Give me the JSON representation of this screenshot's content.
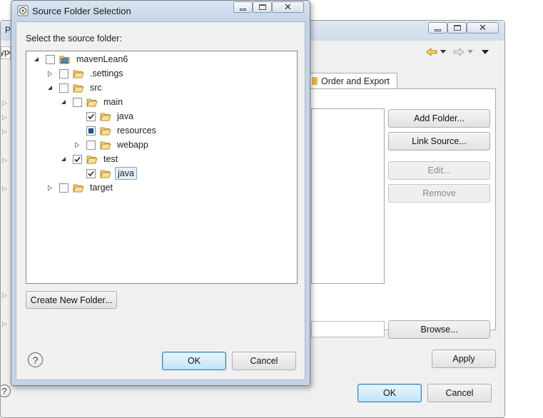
{
  "background_window": {
    "partial_title": "P",
    "partial_text": "ype",
    "tab_order_export": "Order and Export",
    "buttons": {
      "add_folder": "Add Folder...",
      "link_source": "Link Source...",
      "edit": "Edit...",
      "remove": "Remove",
      "browse": "Browse...",
      "apply": "Apply",
      "ok": "OK",
      "cancel": "Cancel"
    }
  },
  "dialog": {
    "title": "Source Folder Selection",
    "prompt": "Select the source folder:",
    "tree": [
      {
        "label": "mavenLean6",
        "expander": "expanded",
        "check": "unchecked",
        "level": 0
      },
      {
        "label": ".settings",
        "expander": "collapsed",
        "check": "unchecked",
        "level": 1
      },
      {
        "label": "src",
        "expander": "expanded",
        "check": "unchecked",
        "level": 1
      },
      {
        "label": "main",
        "expander": "expanded",
        "check": "unchecked",
        "level": 2
      },
      {
        "label": "java",
        "expander": "none",
        "check": "checked",
        "level": 3
      },
      {
        "label": "resources",
        "expander": "none",
        "check": "partial",
        "level": 3
      },
      {
        "label": "webapp",
        "expander": "collapsed",
        "check": "unchecked",
        "level": 3
      },
      {
        "label": "test",
        "expander": "expanded",
        "check": "checked",
        "level": 2
      },
      {
        "label": "java",
        "expander": "none",
        "check": "checked",
        "level": 3,
        "selected": true
      },
      {
        "label": "target",
        "expander": "collapsed",
        "check": "unchecked",
        "level": 1
      }
    ],
    "create_folder_label": "Create New Folder...",
    "ok_label": "OK",
    "cancel_label": "Cancel"
  },
  "colors": {
    "accent": "#3c7fb1",
    "folder": "#e9b945",
    "check": "#1b5fa4"
  },
  "icons": [
    "eclipse-icon",
    "minimize-icon",
    "maximize-icon",
    "close-icon",
    "help-icon",
    "folder-icon",
    "project-icon",
    "back-arrow-icon",
    "forward-arrow-icon",
    "menu-arrow-icon"
  ]
}
